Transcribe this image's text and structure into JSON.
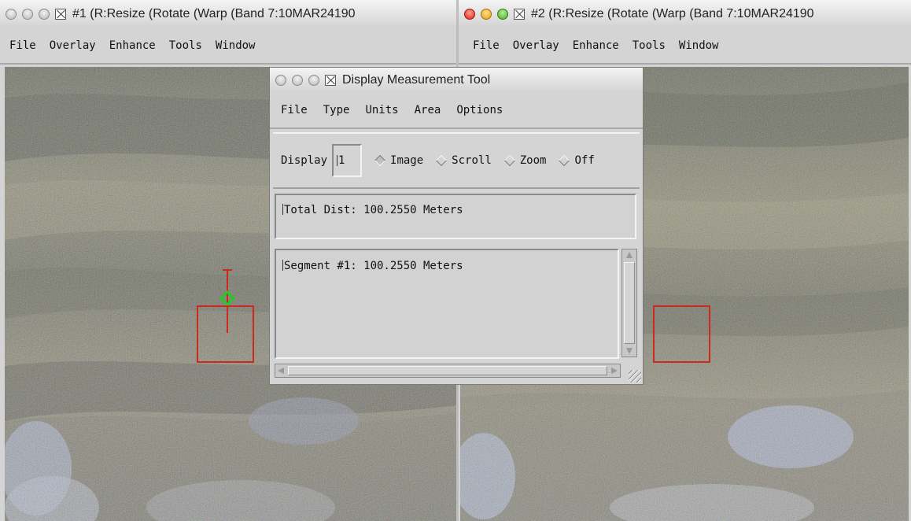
{
  "window1": {
    "title": "#1 (R:Resize (Rotate (Warp (Band 7:10MAR24190",
    "menu": [
      "File",
      "Overlay",
      "Enhance",
      "Tools",
      "Window"
    ]
  },
  "window2": {
    "title": "#2 (R:Resize (Rotate (Warp (Band 7:10MAR24190",
    "menu": [
      "File",
      "Overlay",
      "Enhance",
      "Tools",
      "Window"
    ]
  },
  "measurement_tool": {
    "title": "Display Measurement Tool",
    "menu": [
      "File",
      "Type",
      "Units",
      "Area",
      "Options"
    ],
    "display_label": "Display",
    "display_value": "1",
    "radio_options": [
      {
        "label": "Image",
        "selected": true
      },
      {
        "label": "Scroll",
        "selected": false
      },
      {
        "label": "Zoom",
        "selected": false
      },
      {
        "label": "Off",
        "selected": false
      }
    ],
    "total_dist": "Total Dist: 100.2550 Meters",
    "segment": "Segment #1: 100.2550 Meters"
  },
  "colors": {
    "window_bg": "#d4d4d4",
    "roi_box": "#cc2a1c",
    "cursor_marker": "#22cc22",
    "close_button": "#d9261a",
    "minimize_button": "#e59e16",
    "zoom_button": "#4aae28"
  },
  "icons": [
    "x11-window-icon",
    "window-control-button",
    "roi-box",
    "cursor-crosshair-icon"
  ]
}
